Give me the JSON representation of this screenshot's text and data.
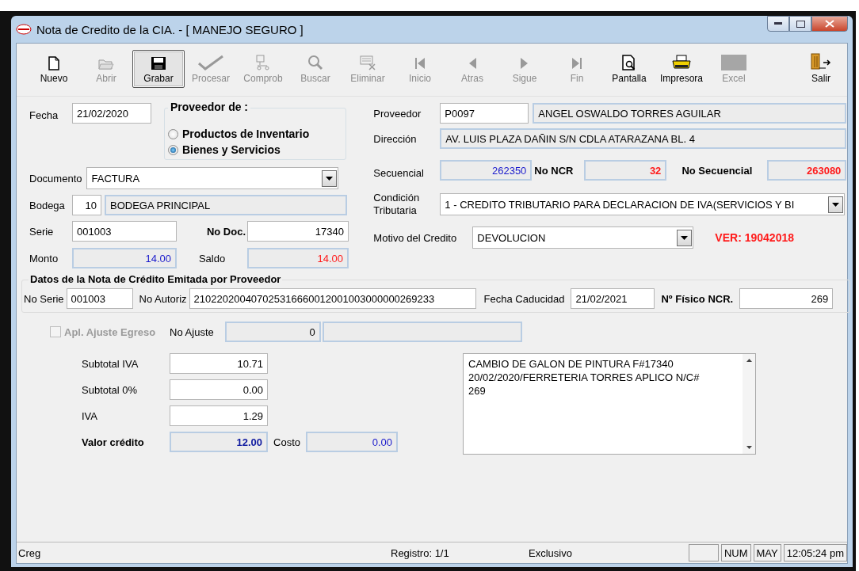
{
  "window": {
    "title": "Nota de Credito de la CIA. - [ MANEJO SEGURO ]"
  },
  "toolbar": [
    {
      "kind": "new",
      "label": "Nuevo",
      "disabled": false,
      "selected": false
    },
    {
      "kind": "open",
      "label": "Abrir",
      "disabled": true,
      "selected": false
    },
    {
      "kind": "save",
      "label": "Grabar",
      "disabled": false,
      "selected": true
    },
    {
      "kind": "process",
      "label": "Procesar",
      "disabled": true,
      "selected": false
    },
    {
      "kind": "network",
      "label": "Comprob",
      "disabled": true,
      "selected": false
    },
    {
      "kind": "search",
      "label": "Buscar",
      "disabled": true,
      "selected": false
    },
    {
      "kind": "delete",
      "label": "Eliminar",
      "disabled": true,
      "selected": false
    },
    {
      "kind": "first",
      "label": "Inicio",
      "disabled": true,
      "selected": false
    },
    {
      "kind": "prev",
      "label": "Atras",
      "disabled": true,
      "selected": false
    },
    {
      "kind": "next",
      "label": "Sigue",
      "disabled": true,
      "selected": false
    },
    {
      "kind": "last",
      "label": "Fin",
      "disabled": true,
      "selected": false
    },
    {
      "kind": "preview",
      "label": "Pantalla",
      "disabled": false,
      "selected": false
    },
    {
      "kind": "print",
      "label": "Impresora",
      "disabled": false,
      "selected": false
    },
    {
      "kind": "excel",
      "label": "Excel",
      "disabled": true,
      "selected": false
    },
    {
      "kind": "exit",
      "label": "Salir",
      "disabled": false,
      "selected": false
    }
  ],
  "fecha": {
    "label": "Fecha",
    "value": "21/02/2020"
  },
  "proveedor_de": {
    "title": "Proveedor  de :",
    "options": [
      {
        "label": "Productos de Inventario",
        "selected": false
      },
      {
        "label": "Bienes y Servicios",
        "selected": true
      }
    ]
  },
  "documento": {
    "label": "Documento",
    "value": "FACTURA"
  },
  "bodega": {
    "label": "Bodega",
    "code": "10",
    "name": "BODEGA PRINCIPAL"
  },
  "serie": {
    "label": "Serie",
    "value": "001003"
  },
  "no_doc": {
    "label": "No Doc.",
    "value": "17340"
  },
  "monto": {
    "label": "Monto",
    "value": "14.00"
  },
  "saldo": {
    "label": "Saldo",
    "value": "14.00"
  },
  "proveedor": {
    "label": "Proveedor",
    "code": "P0097",
    "name": "ANGEL OSWALDO TORRES AGUILAR"
  },
  "direccion": {
    "label": "Dirección",
    "value": "AV. LUIS PLAZA DAÑIN S/N CDLA ATARAZANA BL. 4"
  },
  "secuencial": {
    "label": "Secuencial",
    "value": "262350"
  },
  "no_ncr": {
    "label": "No NCR",
    "value": "32"
  },
  "no_secuencial": {
    "label": "No Secuencial",
    "value": "263080"
  },
  "condicion": {
    "label": "Condición Tributaria",
    "value": "1 - CREDITO TRIBUTARIO PARA DECLARACION DE IVA(SERVICIOS Y BI"
  },
  "motivo": {
    "label": "Motivo del Credito",
    "value": "DEVOLUCION"
  },
  "version": "VER: 19042018",
  "datos_nc": {
    "title": "Datos de la Nota de Crédito Emitada por Proveedor",
    "no_serie": {
      "label": "No Serie",
      "value": "001003"
    },
    "no_autoriz": {
      "label": "No Autoriz",
      "value": "210220200407025316660012001003000000269233"
    },
    "fecha_caducidad": {
      "label": "Fecha Caducidad",
      "value": "21/02/2021"
    },
    "no_fisico": {
      "label": "Nº Físico NCR.",
      "value": "269"
    }
  },
  "ajuste": {
    "label": "Apl. Ajuste Egreso",
    "checked": false,
    "disabled": true
  },
  "no_ajuste": {
    "label": "No Ajuste",
    "value": "0"
  },
  "totales": [
    {
      "label": "Subtotal IVA",
      "value": "10.71"
    },
    {
      "label": "Subtotal 0%",
      "value": "0.00"
    },
    {
      "label": "IVA",
      "value": "1.29"
    }
  ],
  "valor_credito": {
    "label": "Valor crédito",
    "value": "12.00"
  },
  "costo": {
    "label": "Costo",
    "value": "0.00"
  },
  "observacion": "CAMBIO DE GALON DE PINTURA F#17340 20/02/2020/FERRETERIA TORRES APLICO N/C# 269",
  "status_bar": {
    "left": "Creg",
    "registro": "Registro: 1/1",
    "modo": "Exclusivo",
    "indicators": [
      "NUM",
      "MAY",
      "12:05:24 pm"
    ]
  }
}
